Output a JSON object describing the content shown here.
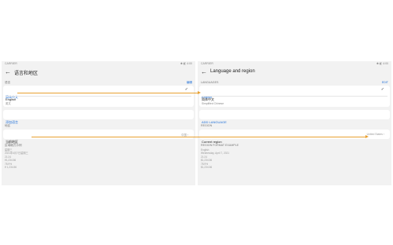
{
  "left": {
    "status": {
      "carrier": "CARRIER",
      "icons": "✱ ◧ 4:00"
    },
    "title": "语言和地区",
    "languages_label": "语言",
    "edit_label": "编辑",
    "languages": [
      {
        "name": "简体中文",
        "sub": ""
      },
      {
        "name": "English",
        "sub": "英文"
      }
    ],
    "add_language": "添加语言",
    "region_label": "地区",
    "region_row": "当前地区",
    "region_value": "中国",
    "format_example_label": "区域格式示例",
    "format_example": "星期三\n2021年4月7日星期三\n21:24\n¥1,234.56\n78.9%\n¥ 1,234.56"
  },
  "right": {
    "status": {
      "carrier": "CARRIER",
      "icons": "✱ ◧ 4:00"
    },
    "title": "Language and region",
    "languages_label": "LANGUAGES",
    "edit_label": "EDIT",
    "languages": [
      {
        "name": "English",
        "sub": ""
      },
      {
        "name": "简体中文",
        "sub": "Simplified Chinese"
      }
    ],
    "add_language": "ADD LANGUAGE",
    "region_label": "REGION",
    "region_row": "Current region",
    "region_value": "United States",
    "format_example_label": "REGION FORMAT EXAMPLE",
    "format_example": "English\nWednesday, April 7, 2021\n21:24\n$1,234.56\n78.9%\n$1,234.56"
  },
  "colors": {
    "accent": "#1f6fd8",
    "annotation_arrow": "#e8a030",
    "panel_bg": "#f2f2f2"
  }
}
